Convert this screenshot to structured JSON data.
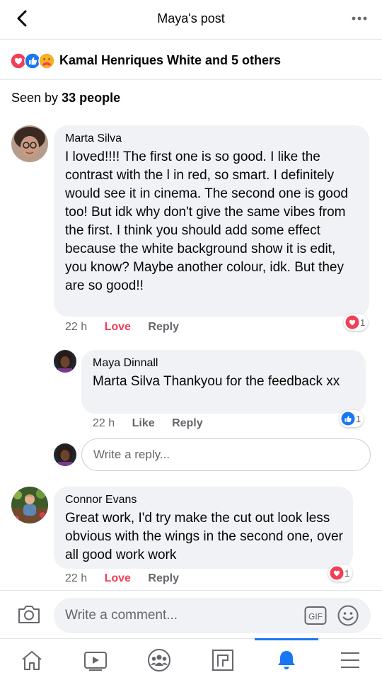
{
  "header": {
    "title": "Maya's post"
  },
  "reactions": {
    "text": "Kamal Henriques White and 5 others"
  },
  "seen": {
    "prefix": "Seen by ",
    "count": "33 people"
  },
  "comments": [
    {
      "author": "Marta Silva",
      "text": "I loved!!!! The first one is so good. I like the contrast with the l in red, so smart. I definitely would see it in cinema. The second one is good too! But idk why don't give the same vibes from the first. I think you should add some effect because the white background show it is edit, you know? Maybe another colour, idk. But they are so good!!",
      "time": "22 h",
      "reaction_action": "Love",
      "reply": "Reply",
      "reaction_count": "1",
      "reaction_type": "love",
      "replies": [
        {
          "author": "Maya Dinnall",
          "mention": "Marta Silva",
          "text": " Thankyou for the feedback xx",
          "time": "22 h",
          "reaction_action": "Like",
          "reply": "Reply",
          "reaction_count": "1",
          "reaction_type": "like"
        }
      ],
      "reply_placeholder": "Write a reply..."
    },
    {
      "author": "Connor Evans",
      "text": "Great work, I'd try make the cut out look less obvious with the wings in the second one, over all good work work",
      "time": "22 h",
      "reaction_action": "Love",
      "reply": "Reply",
      "reaction_count": "1",
      "reaction_type": "love"
    }
  ],
  "composer": {
    "placeholder": "Write a comment...",
    "gif": "GIF"
  },
  "nav": {
    "active": "notifications"
  },
  "colors": {
    "accent": "#1877f2",
    "love": "#f33e58",
    "bubble": "#f0f2f5",
    "muted": "#65676b"
  }
}
